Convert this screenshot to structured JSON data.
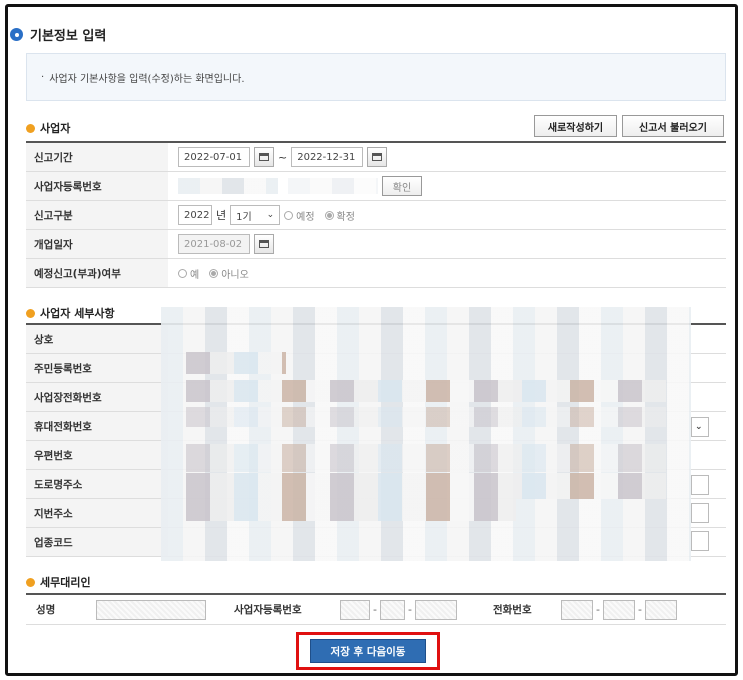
{
  "page": {
    "title": "기본정보 입력",
    "notice": "사업자 기본사항을 입력(수정)하는 화면입니다."
  },
  "business": {
    "section_title": "사업자",
    "buttons": {
      "new": "새로작성하기",
      "load": "신고서 불러오기"
    },
    "rows": {
      "period_label": "신고기간",
      "period_start": "2022-07-01",
      "period_sep": "~",
      "period_end": "2022-12-31",
      "reg_label": "사업자등록번호",
      "confirm": "확인",
      "type_label": "신고구분",
      "type_year": "2022",
      "type_year_unit": "년",
      "type_term": "1기",
      "type_opt1": "예정",
      "type_opt2": "확정",
      "open_label": "개업일자",
      "open_date": "2021-08-02",
      "prelim_label": "예정신고(부과)여부",
      "prelim_yes": "예",
      "prelim_no": "아니오"
    }
  },
  "details": {
    "section_title": "사업자 세부사항",
    "labels": [
      "상호",
      "주민등록번호",
      "사업장전화번호",
      "휴대전화번호",
      "우편번호",
      "도로명주소",
      "지번주소",
      "업종코드"
    ]
  },
  "agent": {
    "section_title": "세무대리인",
    "name_label": "성명",
    "reg_label": "사업자등록번호",
    "phone_label": "전화번호",
    "sep": "-"
  },
  "footer": {
    "save": "저장 후 다음이동"
  }
}
